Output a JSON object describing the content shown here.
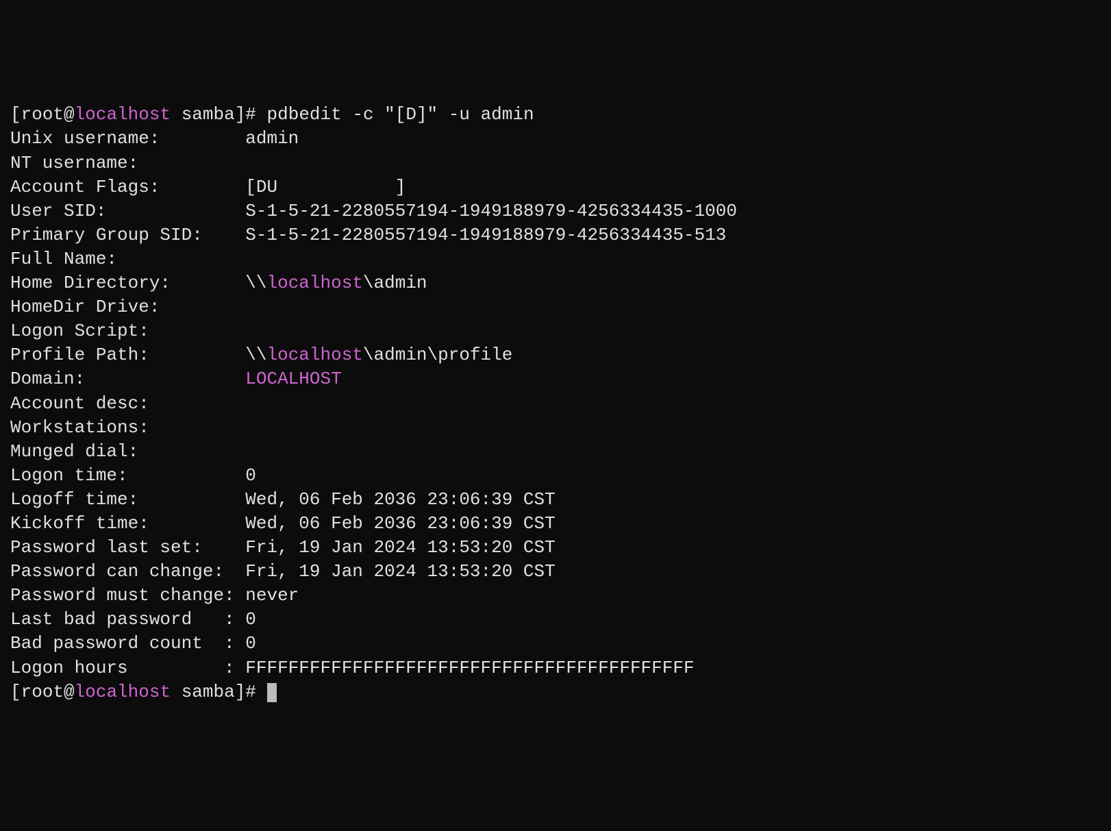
{
  "prompt": {
    "open": "[",
    "user": "root",
    "at": "@",
    "host": "localhost",
    "space": " ",
    "dir": "samba",
    "close": "]# ",
    "cmd": "pdbedit -c \"[D]\" -u admin"
  },
  "labels": {
    "unix_username": "Unix username:        ",
    "nt_username": "NT username:",
    "account_flags": "Account Flags:        ",
    "user_sid": "User SID:             ",
    "pgroup_sid": "Primary Group SID:    ",
    "full_name": "Full Name:",
    "home_dir": "Home Directory:       ",
    "homedir_drive": "HomeDir Drive:",
    "logon_script": "Logon Script:",
    "profile_path": "Profile Path:         ",
    "domain": "Domain:               ",
    "account_desc": "Account desc:",
    "workstations": "Workstations:",
    "munged_dial": "Munged dial:",
    "logon_time": "Logon time:           ",
    "logoff_time": "Logoff time:          ",
    "kickoff_time": "Kickoff time:         ",
    "pw_last_set": "Password last set:    ",
    "pw_can_change": "Password can change:  ",
    "pw_must_change": "Password must change: ",
    "last_bad_pw": "Last bad password   : ",
    "bad_pw_count": "Bad password count  : ",
    "logon_hours": "Logon hours         : "
  },
  "values": {
    "unix_username": "admin",
    "nt_username": "",
    "account_flags": "[DU           ]",
    "user_sid": "S-1-5-21-2280557194-1949188979-4256334435-1000",
    "pgroup_sid": "S-1-5-21-2280557194-1949188979-4256334435-513",
    "full_name": "",
    "home_dir_prefix": "\\\\",
    "home_dir_host": "localhost",
    "home_dir_suffix": "\\admin",
    "homedir_drive": "",
    "logon_script": "",
    "profile_prefix": "\\\\",
    "profile_host": "localhost",
    "profile_suffix": "\\admin\\profile",
    "domain": "LOCALHOST",
    "account_desc": "",
    "workstations": "",
    "munged_dial": "",
    "logon_time": "0",
    "logoff_time": "Wed, 06 Feb 2036 23:06:39 CST",
    "kickoff_time": "Wed, 06 Feb 2036 23:06:39 CST",
    "pw_last_set": "Fri, 19 Jan 2024 13:53:20 CST",
    "pw_can_change": "Fri, 19 Jan 2024 13:53:20 CST",
    "pw_must_change": "never",
    "last_bad_pw": "0",
    "bad_pw_count": "0",
    "logon_hours": "FFFFFFFFFFFFFFFFFFFFFFFFFFFFFFFFFFFFFFFFFF"
  },
  "prompt2": {
    "open": "[",
    "user": "root",
    "at": "@",
    "host": "localhost",
    "space": " ",
    "dir": "samba",
    "close": "]# "
  }
}
